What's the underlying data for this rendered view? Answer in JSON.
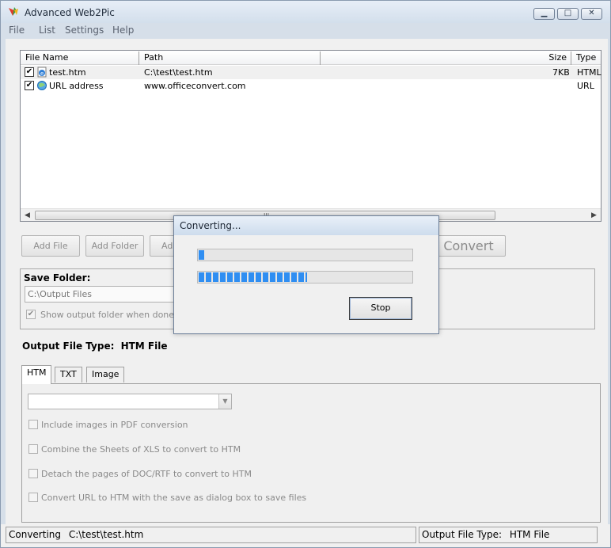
{
  "window": {
    "title": "Advanced Web2Pic",
    "controls": {
      "minimize": "▁",
      "maximize": "□",
      "close": "✕"
    }
  },
  "menu": [
    "File",
    "List",
    "Settings",
    "Help"
  ],
  "file_list": {
    "columns": [
      "File Name",
      "Path",
      "",
      "Size",
      "Type"
    ],
    "rows": [
      {
        "checked": true,
        "name": "test.htm",
        "path": "C:\\test\\test.htm",
        "size": "7KB",
        "type": "HTML",
        "icon": "ie-file-icon"
      },
      {
        "checked": true,
        "name": "URL address",
        "path": "www.officeconvert.com",
        "size": "",
        "type": "URL",
        "icon": "ie-url-icon"
      }
    ],
    "scroll_grip": "III"
  },
  "buttons": {
    "add_file": "Add File",
    "add_folder": "Add Folder",
    "add_partial": "Ad",
    "convert": "Convert"
  },
  "save_folder": {
    "title": "Save Folder:",
    "value": "C:\\Output Files",
    "show_when_done": "Show output folder when done",
    "show_when_done_checked": true
  },
  "output_file_type": {
    "label": "Output File Type:",
    "value": "HTM File"
  },
  "tabs": [
    "HTM",
    "TXT",
    "Image"
  ],
  "options": [
    "Include images in PDF conversion",
    "Combine the Sheets of XLS to convert to HTM",
    "Detach the pages of DOC/RTF to convert to HTM",
    "Convert URL to HTM with the save as dialog box to save files"
  ],
  "status": {
    "left_label": "Converting",
    "left_value": "C:\\test\\test.htm",
    "right_label": "Output File Type:",
    "right_value": "HTM File"
  },
  "dialog": {
    "title": "Converting...",
    "stop_label": "Stop",
    "progress_file": 0.03,
    "progress_total": 0.51
  },
  "colors": {
    "progress": "#2f8ef2",
    "title_bg": "#d6dfe9"
  }
}
